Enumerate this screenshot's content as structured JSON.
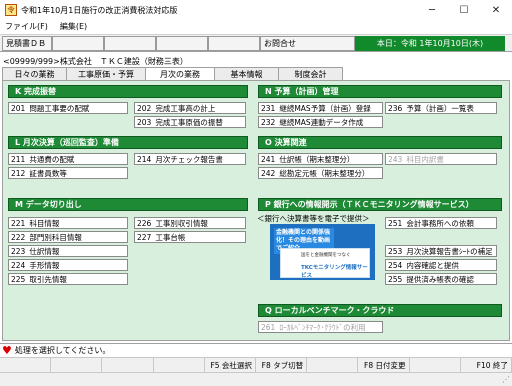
{
  "window": {
    "icon": "tkc-app-icon",
    "title": "令和1年10月1日施行の改正消費税法対応版",
    "minimize": "─",
    "maximize": "☐",
    "close": "✕"
  },
  "menu": [
    "ファイル(F)",
    "編集(E)"
  ],
  "toolbar": {
    "estimate_db": "見積書ＤＢ",
    "inquiry": "お問合せ",
    "today": "本日：令和 1年10月10日(木)"
  },
  "company": "<09999/999>株式会社　ＴＫＣ建設（財務三表）",
  "tabs": [
    "日々の業務",
    "工事原価・予算",
    "月次の業務",
    "基本情報",
    "制度会計"
  ],
  "active_tab": "月次の業務",
  "sections": {
    "k": {
      "title": "K 完成振替",
      "items": [
        [
          "201",
          "問題工事要の配賦"
        ],
        [
          "202",
          "完成工事高の計上"
        ],
        [
          "203",
          "完成工事原価の振替"
        ]
      ]
    },
    "n": {
      "title": "N 予算（計画）管理",
      "items": [
        [
          "231",
          "継続MAS予算（計画）登録"
        ],
        [
          "236",
          "予算（計画）一覧表"
        ],
        [
          "232",
          "継続MAS連動データ作成"
        ]
      ]
    },
    "l": {
      "title": "L 月次決算（巡回監査）準備",
      "items": [
        [
          "211",
          "共通費の配賦"
        ],
        [
          "214",
          "月次チェック報告書"
        ],
        [
          "212",
          "証書員数等"
        ]
      ]
    },
    "o": {
      "title": "O 決算関連",
      "items": [
        [
          "241",
          "仕訳帳（期末整理分）"
        ],
        [
          "243",
          "科目内訳書"
        ],
        [
          "242",
          "総勘定元帳（期末整理分）"
        ]
      ]
    },
    "m": {
      "title": "M データ切り出し",
      "items": [
        [
          "221",
          "科目情報"
        ],
        [
          "226",
          "工事別収引情報"
        ],
        [
          "222",
          "部門別科目情報"
        ],
        [
          "227",
          "工事台帳"
        ],
        [
          "223",
          "仕訳情報"
        ],
        [
          "224",
          "手形情報"
        ],
        [
          "225",
          "取引先情報"
        ]
      ]
    },
    "p": {
      "title": "P 銀行への情報開示（ＴＫＣモニタリング情報サービス）",
      "items": [
        [
          "251",
          "会計事務所への依頼"
        ],
        [
          "253",
          "月次決算報告書ｼｰﾄの補足"
        ],
        [
          "254",
          "内容確認と提供"
        ],
        [
          "255",
          "提供済み帳表の確認"
        ]
      ]
    },
    "q": {
      "title": "Q ローカルベンチマーク・クラウド",
      "items": [
        [
          "261",
          "ﾛｰｶﾙﾍﾞﾝﾁﾏｰｸ･ｸﾗｳﾄﾞの利用"
        ]
      ]
    }
  },
  "bank_note": "＜銀行へ決算書等を電子で提供＞",
  "banner": {
    "headline": "金融機関との関係強化！その理由を動画でご紹介",
    "card_small": "国をと金融機関をつなぐ",
    "card_title": "TKCモニタリング情報サービス"
  },
  "status": {
    "icon": "heart-icon",
    "message": "処理を選択してください。"
  },
  "fkeys": [
    "",
    "",
    "",
    "",
    "F5 会社選択",
    "F8 タブ切替",
    "",
    "F8 日付変更",
    "",
    "F10 終了"
  ]
}
